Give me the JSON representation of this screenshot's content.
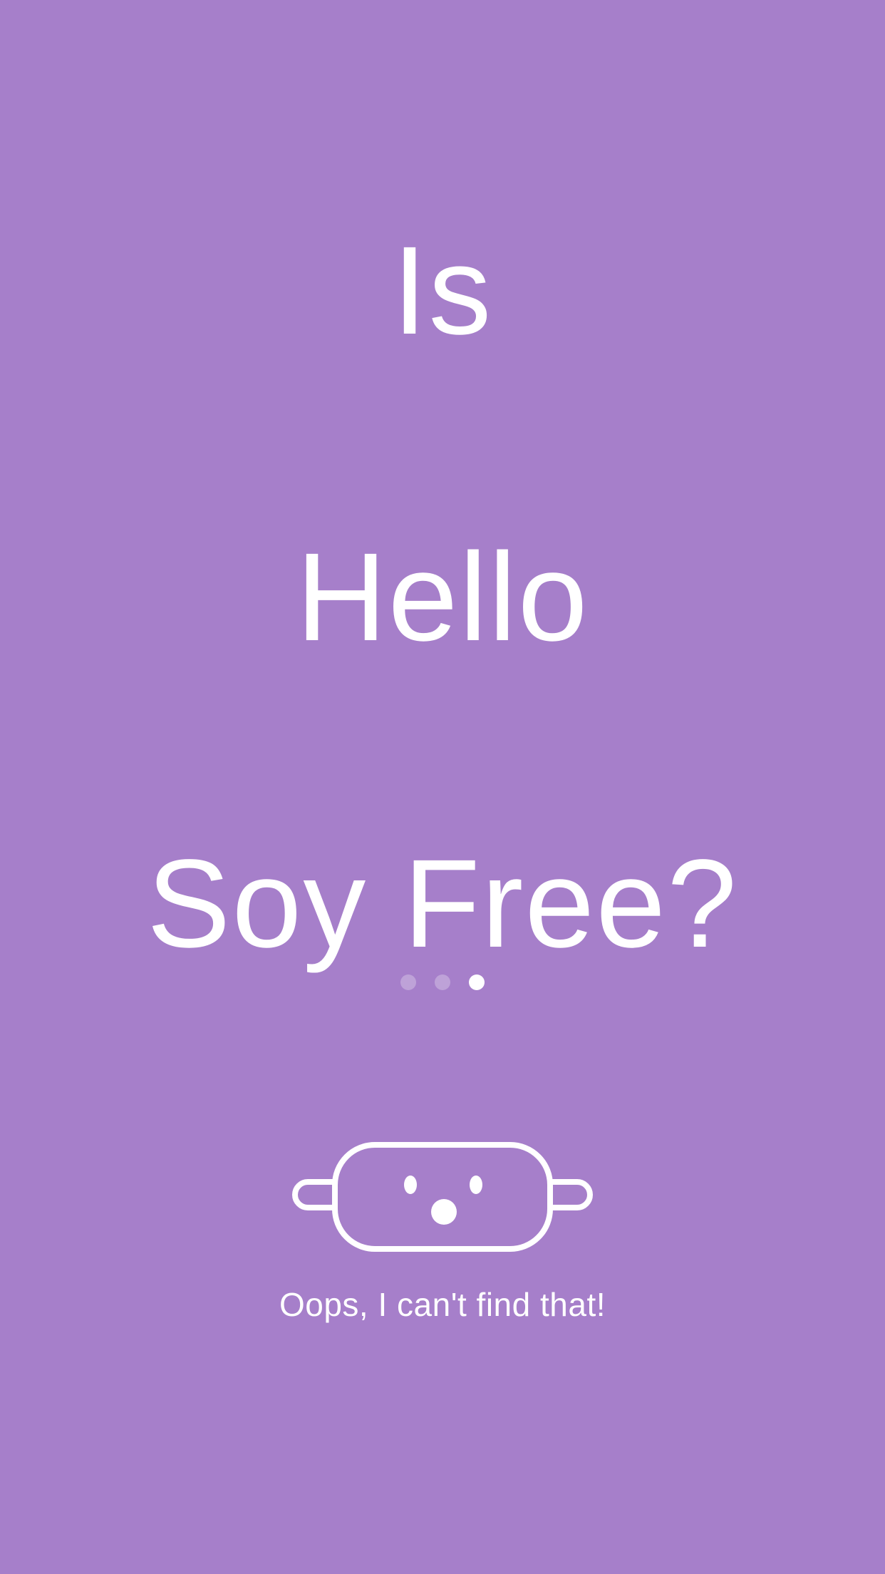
{
  "headline": {
    "line1": "Is",
    "line2": "Hello",
    "line3": "Soy Free?"
  },
  "pager": {
    "total": 3,
    "active_index": 2
  },
  "mascot": {
    "icon": "rolling-pin-face-icon"
  },
  "message": "Oops, I can't find that!",
  "colors": {
    "background": "#a67fca",
    "foreground": "#ffffff"
  }
}
